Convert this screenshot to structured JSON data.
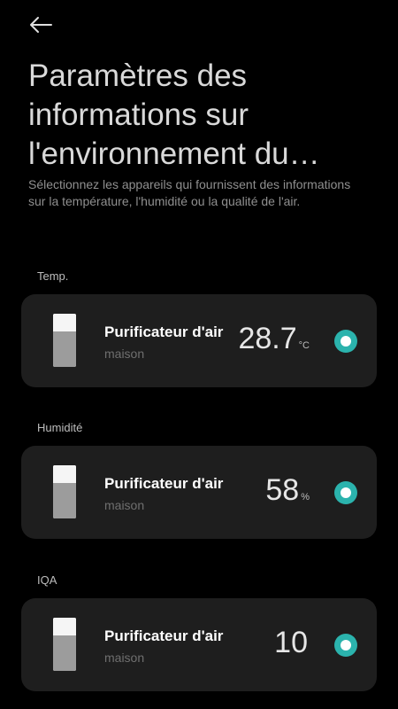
{
  "header": {
    "title": "Paramètres des informations sur l'environnement du domicile",
    "subtitle": "Sélectionnez les appareils qui fournissent des informations sur la température, l'humidité ou la qualité de l'air."
  },
  "sections": [
    {
      "label": "Temp.",
      "device": {
        "name": "Purificateur d'air",
        "room": "maison",
        "value": "28.7",
        "unit": "°C",
        "selected": true
      }
    },
    {
      "label": "Humidité",
      "device": {
        "name": "Purificateur d'air",
        "room": "maison",
        "value": "58",
        "unit": "%",
        "selected": true
      }
    },
    {
      "label": "IQA",
      "device": {
        "name": "Purificateur d'air",
        "room": "maison",
        "value": "10",
        "unit": "",
        "selected": true
      }
    }
  ],
  "colors": {
    "accent": "#2bb3ad",
    "card": "#1e1e1e",
    "background": "#000000"
  },
  "icons": {
    "back": "arrow-left-icon",
    "device": "air-purifier-icon"
  }
}
